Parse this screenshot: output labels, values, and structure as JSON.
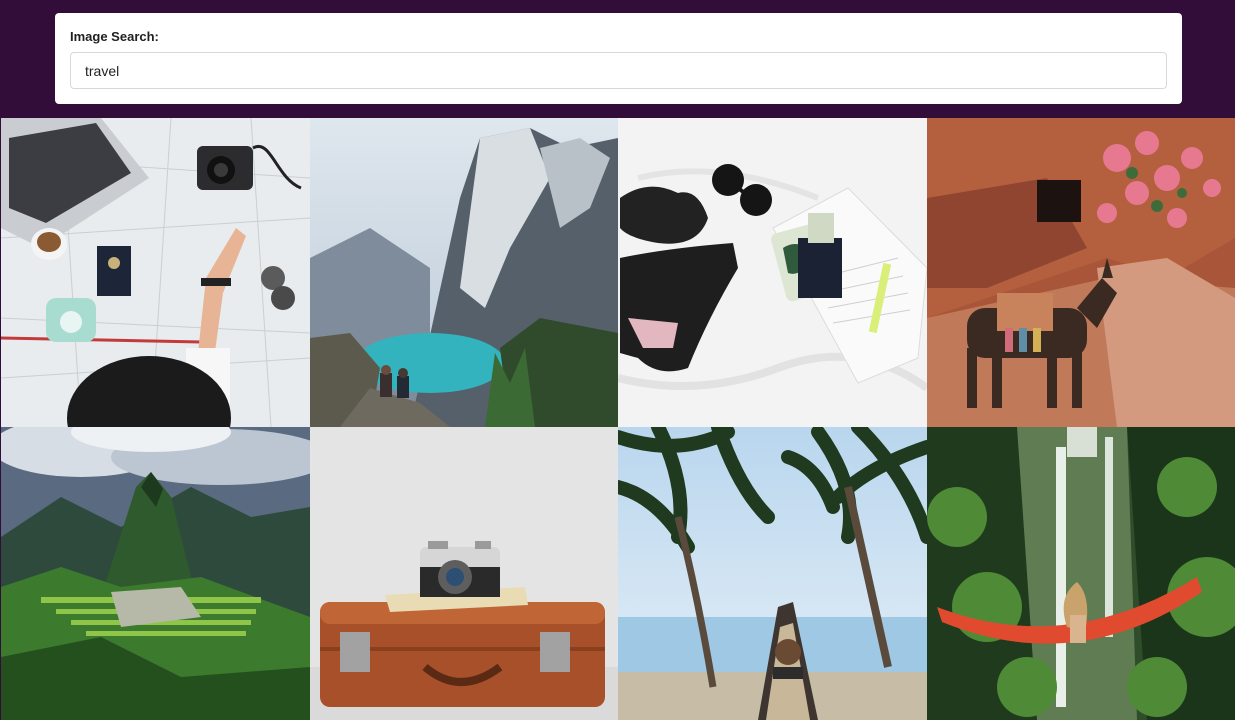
{
  "search": {
    "label": "Image Search:",
    "value": "travel"
  },
  "results": [
    {
      "subject": "flat-lay-map-laptop-camera-passport-photo"
    },
    {
      "subject": "mountain-lake-hikers-photo"
    },
    {
      "subject": "swimsuit-sunglasses-passport-photo"
    },
    {
      "subject": "donkey-red-rock-flowers-photo"
    },
    {
      "subject": "machu-picchu-photo"
    },
    {
      "subject": "camera-on-suitcase-photo"
    },
    {
      "subject": "palm-trees-boat-beach-photo"
    },
    {
      "subject": "hammock-waterfall-jungle-photo"
    }
  ]
}
